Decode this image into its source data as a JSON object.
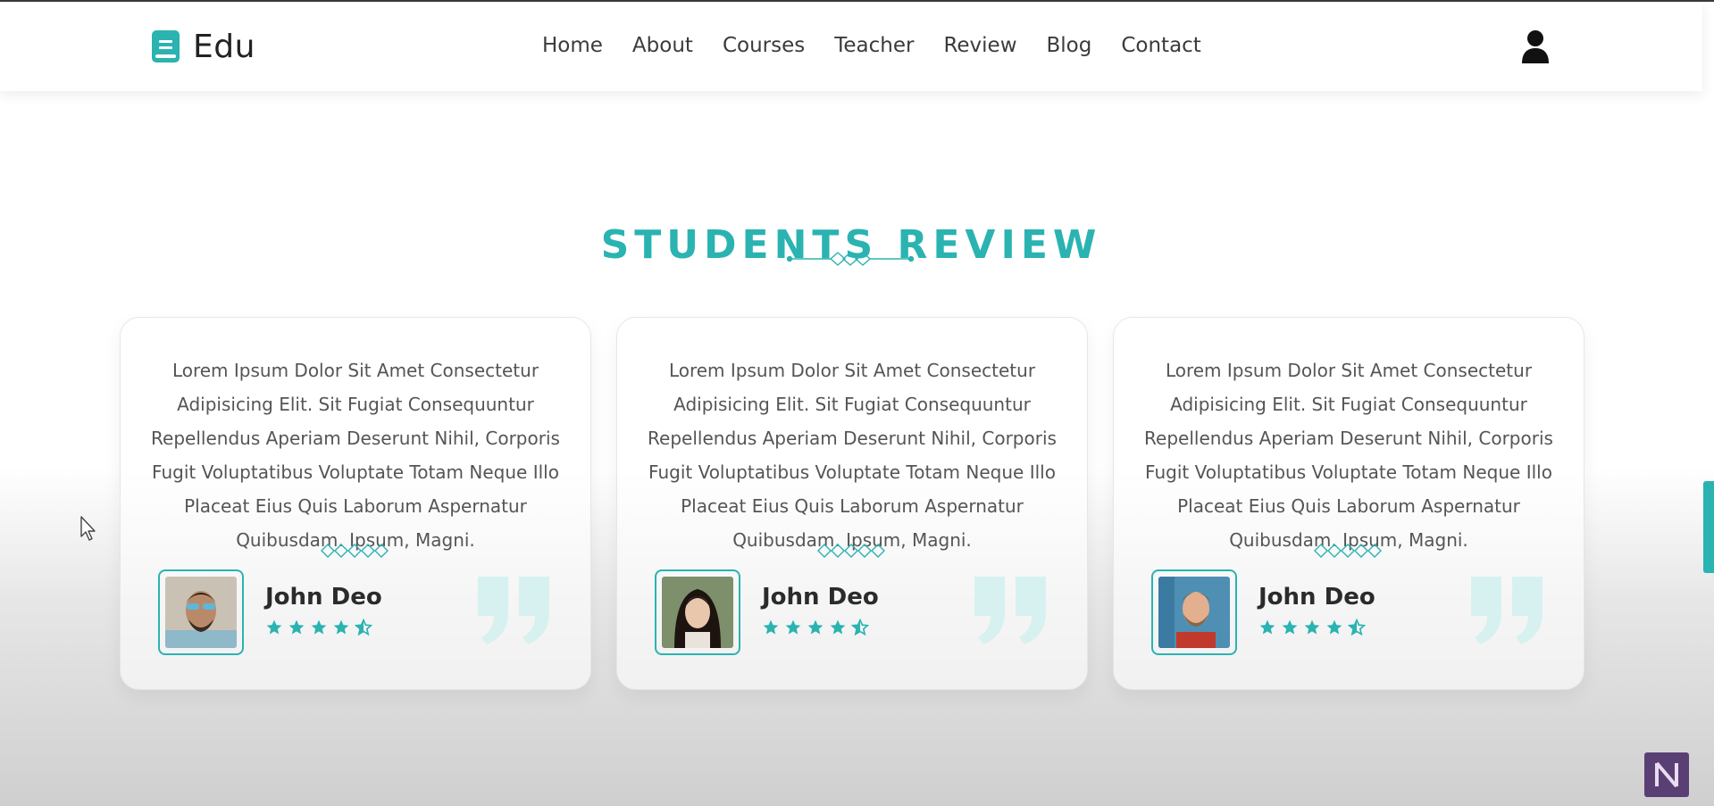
{
  "header": {
    "logo_text": "Edu",
    "nav": [
      "Home",
      "About",
      "Courses",
      "Teacher",
      "Review",
      "Blog",
      "Contact"
    ]
  },
  "section": {
    "title": "STUDENTS REVIEW"
  },
  "reviews": [
    {
      "text": "Lorem Ipsum Dolor Sit Amet Consectetur Adipisicing Elit. Sit Fugiat Consequuntur Repellendus Aperiam Deserunt Nihil, Corporis Fugit Voluptatibus Voluptate Totam Neque Illo Placeat Eius Quis Laborum Aspernatur Quibusdam. Ipsum, Magni.",
      "name": "John Deo",
      "rating": 4.5
    },
    {
      "text": "Lorem Ipsum Dolor Sit Amet Consectetur Adipisicing Elit. Sit Fugiat Consequuntur Repellendus Aperiam Deserunt Nihil, Corporis Fugit Voluptatibus Voluptate Totam Neque Illo Placeat Eius Quis Laborum Aspernatur Quibusdam. Ipsum, Magni.",
      "name": "John Deo",
      "rating": 4.5
    },
    {
      "text": "Lorem Ipsum Dolor Sit Amet Consectetur Adipisicing Elit. Sit Fugiat Consequuntur Repellendus Aperiam Deserunt Nihil, Corporis Fugit Voluptatibus Voluptate Totam Neque Illo Placeat Eius Quis Laborum Aspernatur Quibusdam. Ipsum, Magni.",
      "name": "John Deo",
      "rating": 4.5
    }
  ],
  "colors": {
    "accent": "#2ab3b1",
    "text": "#555555",
    "heading": "#2b2b2b"
  },
  "icons": [
    "book-icon",
    "user-icon",
    "star-icon",
    "half-star-icon",
    "quote-icon",
    "diamond-divider-icon"
  ]
}
